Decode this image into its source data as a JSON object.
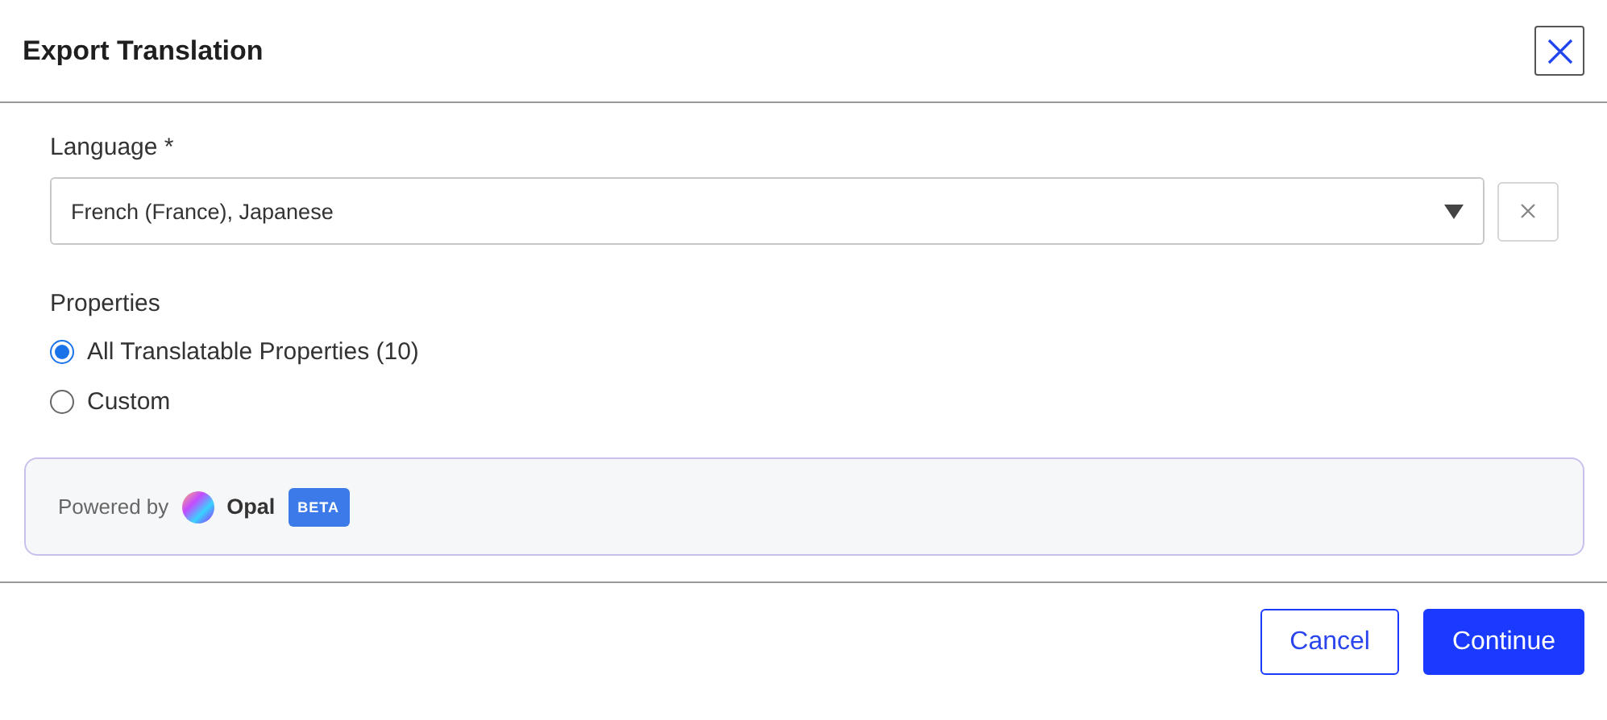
{
  "dialog": {
    "title": "Export Translation"
  },
  "language": {
    "label": "Language *",
    "value": "French (France), Japanese"
  },
  "properties": {
    "label": "Properties",
    "options": [
      {
        "label": "All Translatable Properties (10)",
        "selected": true
      },
      {
        "label": "Custom",
        "selected": false
      }
    ]
  },
  "powered": {
    "text": "Powered by",
    "brand": "Opal",
    "badge": "BETA"
  },
  "buttons": [
    {
      "label": "Cancel",
      "kind": "secondary"
    },
    {
      "label": "Continue",
      "kind": "primary"
    }
  ]
}
